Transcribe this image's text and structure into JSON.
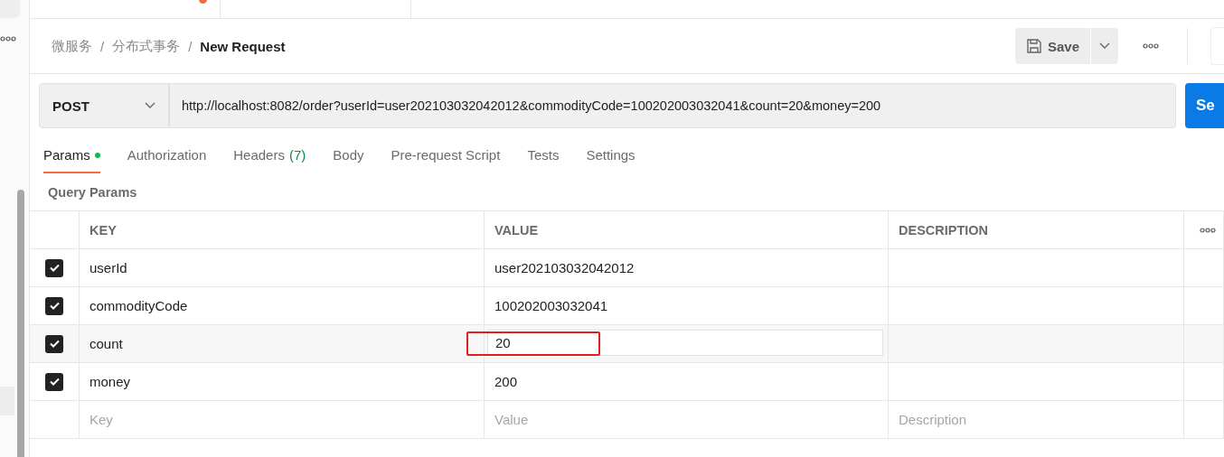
{
  "breadcrumb": [
    "微服务",
    "分布式事务",
    "New Request"
  ],
  "breadcrumb_separators": [
    "/",
    "/"
  ],
  "save_button": "Save",
  "request": {
    "method": "POST",
    "url": "http://localhost:8082/order?userId=user202103032042012&commodityCode=100202003032041&count=20&money=200",
    "send_button": "Se"
  },
  "tabs": [
    {
      "label": "Params",
      "selected": true,
      "dot": true
    },
    {
      "label": "Authorization",
      "selected": false,
      "dot": false
    },
    {
      "label": "Headers",
      "count": "(7)",
      "selected": false,
      "dot": false
    },
    {
      "label": "Body",
      "selected": false,
      "dot": false
    },
    {
      "label": "Pre-request Script",
      "selected": false,
      "dot": false
    },
    {
      "label": "Tests",
      "selected": false,
      "dot": false
    },
    {
      "label": "Settings",
      "selected": false,
      "dot": false
    }
  ],
  "section_title": "Query Params",
  "table": {
    "columns": [
      "KEY",
      "VALUE",
      "DESCRIPTION"
    ],
    "rows": [
      {
        "checked": true,
        "key": "userId",
        "value": "user202103032042012",
        "editing": false,
        "highlighted": false
      },
      {
        "checked": true,
        "key": "commodityCode",
        "value": "100202003032041",
        "editing": false,
        "highlighted": false
      },
      {
        "checked": true,
        "key": "count",
        "value": "20",
        "editing": true,
        "highlighted": true
      },
      {
        "checked": true,
        "key": "money",
        "value": "200",
        "editing": false,
        "highlighted": false
      }
    ],
    "new_row": {
      "key": {
        "placeholder": "Key"
      },
      "value": {
        "placeholder": "Value"
      },
      "description": {
        "placeholder": "Description"
      }
    }
  }
}
